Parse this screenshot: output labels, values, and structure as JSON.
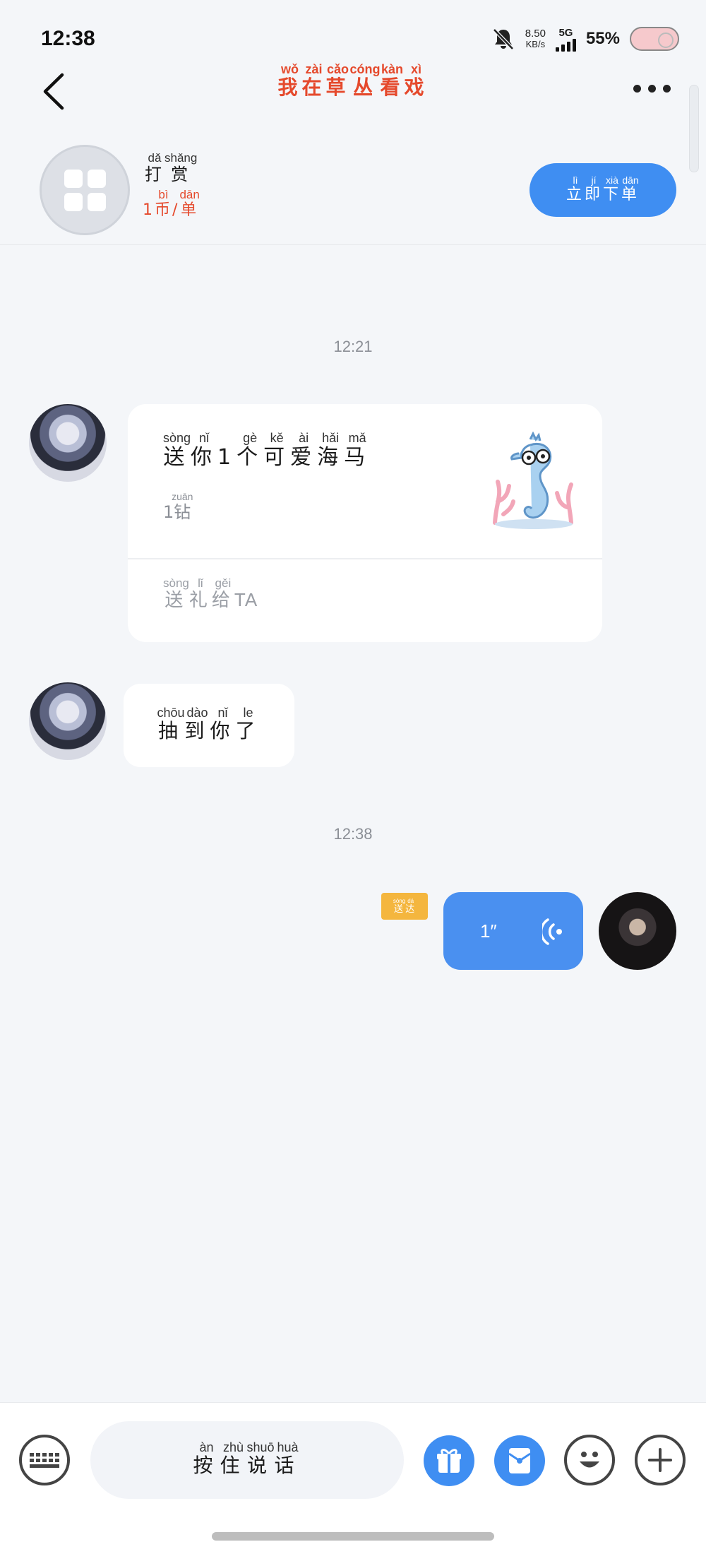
{
  "status_bar": {
    "time": "12:38",
    "net_speed_value": "8.50",
    "net_speed_unit": "KB/s",
    "network": "5G",
    "battery": "55%",
    "icons": [
      "bell-off-icon",
      "signal-icon",
      "battery-icon"
    ]
  },
  "header": {
    "title": [
      {
        "han": "我",
        "py": "wǒ"
      },
      {
        "han": "在",
        "py": "zài"
      },
      {
        "han": "草",
        "py": "cǎo"
      },
      {
        "han": "丛",
        "py": "cóng"
      },
      {
        "han": "看",
        "py": "kàn"
      },
      {
        "han": "戏",
        "py": "xì"
      }
    ],
    "title_color": "#e5492c"
  },
  "tip_bar": {
    "name": [
      {
        "han": "打",
        "py": "dǎ"
      },
      {
        "han": "赏",
        "py": "shǎng"
      }
    ],
    "price_amount": "1",
    "price": [
      {
        "han": "币",
        "py": "bì"
      },
      {
        "han": "/",
        "py": ""
      },
      {
        "han": "单",
        "py": "dān"
      }
    ],
    "order_button": [
      {
        "han": "立",
        "py": "lì"
      },
      {
        "han": "即",
        "py": "jí"
      },
      {
        "han": "下",
        "py": "xià"
      },
      {
        "han": "单",
        "py": "dān"
      }
    ],
    "accent": "#3f8ef2"
  },
  "chat": {
    "timestamps": [
      "12:21",
      "12:38"
    ],
    "gift_message": {
      "text": [
        {
          "han": "送",
          "py": "sòng"
        },
        {
          "han": "你",
          "py": "nǐ"
        },
        {
          "han": "1",
          "py": ""
        },
        {
          "han": "个",
          "py": "gè"
        },
        {
          "han": "可",
          "py": "kě"
        },
        {
          "han": "爱",
          "py": "ài"
        },
        {
          "han": "海",
          "py": "hǎi"
        },
        {
          "han": "马",
          "py": "mǎ"
        }
      ],
      "price_amount": "1",
      "price_unit": [
        {
          "han": "钻",
          "py": "zuān"
        }
      ],
      "send_label": [
        {
          "han": "送",
          "py": "sòng"
        },
        {
          "han": "礼",
          "py": "lǐ"
        },
        {
          "han": "给",
          "py": "gěi"
        }
      ],
      "send_target": "TA",
      "gift_icon": "seahorse-gift-icon"
    },
    "text_message": {
      "text": [
        {
          "han": "抽",
          "py": "chōu"
        },
        {
          "han": "到",
          "py": "dào"
        },
        {
          "han": "你",
          "py": "nǐ"
        },
        {
          "han": "了",
          "py": "le"
        }
      ]
    },
    "voice_message": {
      "duration": "1″",
      "status": [
        {
          "han": "送",
          "py": "sòng"
        },
        {
          "han": "达",
          "py": "dá"
        }
      ]
    }
  },
  "bottom_bar": {
    "hold_to_talk": [
      {
        "han": "按",
        "py": "àn"
      },
      {
        "han": "住",
        "py": "zhù"
      },
      {
        "han": "说",
        "py": "shuō"
      },
      {
        "han": "话",
        "py": "huà"
      }
    ],
    "icons": [
      "keyboard-icon",
      "gift-icon",
      "red-packet-icon",
      "emoji-icon",
      "plus-icon"
    ]
  }
}
